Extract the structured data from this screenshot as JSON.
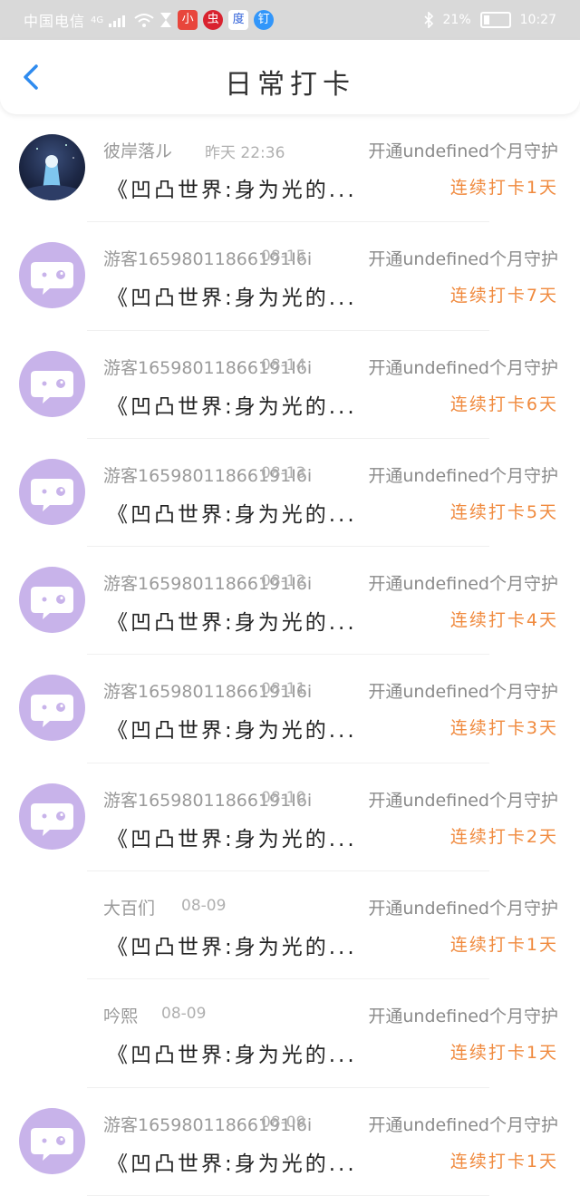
{
  "status_bar": {
    "carrier": "中国电信",
    "network": "4G",
    "battery": "21%",
    "time": "10:27",
    "app_icons": [
      "小",
      "虫",
      "度",
      "钉"
    ]
  },
  "header": {
    "title": "日常打卡"
  },
  "colors": {
    "accent": "#2e8bef",
    "streak": "#f08a3e",
    "avatar_default": "#c8b3ea"
  },
  "rows": [
    {
      "name": "彼岸落ル",
      "date": "昨天 22:36",
      "guard": "开通undefined个月守护",
      "text": "《凹凸世界:身为光的...",
      "streak": "连续打卡1天",
      "avatar": "photo"
    },
    {
      "name": "游客16598011866191I6i",
      "date": "08-15",
      "guard": "开通undefined个月守护",
      "text": "《凹凸世界:身为光的...",
      "streak": "连续打卡7天",
      "avatar": "default"
    },
    {
      "name": "游客16598011866191I6i",
      "date": "08-14",
      "guard": "开通undefined个月守护",
      "text": "《凹凸世界:身为光的...",
      "streak": "连续打卡6天",
      "avatar": "default"
    },
    {
      "name": "游客16598011866191I6i",
      "date": "08-13",
      "guard": "开通undefined个月守护",
      "text": "《凹凸世界:身为光的...",
      "streak": "连续打卡5天",
      "avatar": "default"
    },
    {
      "name": "游客16598011866191I6i",
      "date": "08-12",
      "guard": "开通undefined个月守护",
      "text": "《凹凸世界:身为光的...",
      "streak": "连续打卡4天",
      "avatar": "default"
    },
    {
      "name": "游客16598011866191I6i",
      "date": "08-11",
      "guard": "开通undefined个月守护",
      "text": "《凹凸世界:身为光的...",
      "streak": "连续打卡3天",
      "avatar": "default"
    },
    {
      "name": "游客16598011866191I6i",
      "date": "08-10",
      "guard": "开通undefined个月守护",
      "text": "《凹凸世界:身为光的...",
      "streak": "连续打卡2天",
      "avatar": "default"
    },
    {
      "name": "大百们",
      "date": "08-09",
      "guard": "开通undefined个月守护",
      "text": "《凹凸世界:身为光的...",
      "streak": "连续打卡1天",
      "avatar": "none"
    },
    {
      "name": "吟熙",
      "date": "08-09",
      "guard": "开通undefined个月守护",
      "text": "《凹凸世界:身为光的...",
      "streak": "连续打卡1天",
      "avatar": "none"
    },
    {
      "name": "游客16598011866191I6i",
      "date": "08-09",
      "guard": "开通undefined个月守护",
      "text": "《凹凸世界:身为光的...",
      "streak": "连续打卡1天",
      "avatar": "default"
    }
  ]
}
